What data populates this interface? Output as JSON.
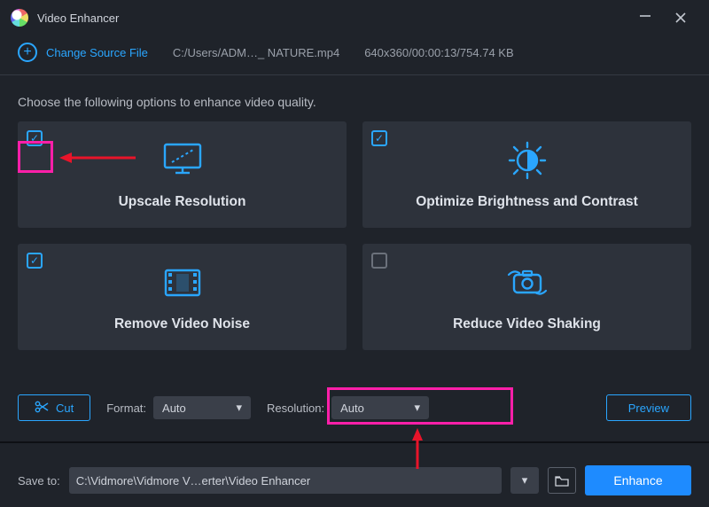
{
  "app": {
    "title": "Video Enhancer"
  },
  "titlebar": {
    "minimize": "—",
    "close": "×"
  },
  "topbar": {
    "change_source_label": "Change Source File",
    "file_path": "C:/Users/ADM…_ NATURE.mp4",
    "file_meta": "640x360/00:00:13/754.74 KB"
  },
  "instruction": "Choose the following options to enhance video quality.",
  "cards": {
    "upscale": {
      "label": "Upscale Resolution",
      "checked": true
    },
    "brightness": {
      "label": "Optimize Brightness and Contrast",
      "checked": true
    },
    "denoise": {
      "label": "Remove Video Noise",
      "checked": true
    },
    "deshake": {
      "label": "Reduce Video Shaking",
      "checked": false
    }
  },
  "controls": {
    "cut_label": "Cut",
    "format_label": "Format:",
    "format_value": "Auto",
    "resolution_label": "Resolution:",
    "resolution_value": "Auto",
    "preview_label": "Preview"
  },
  "footer": {
    "save_to_label": "Save to:",
    "save_path": "C:\\Vidmore\\Vidmore V…erter\\Video Enhancer",
    "enhance_label": "Enhance"
  }
}
